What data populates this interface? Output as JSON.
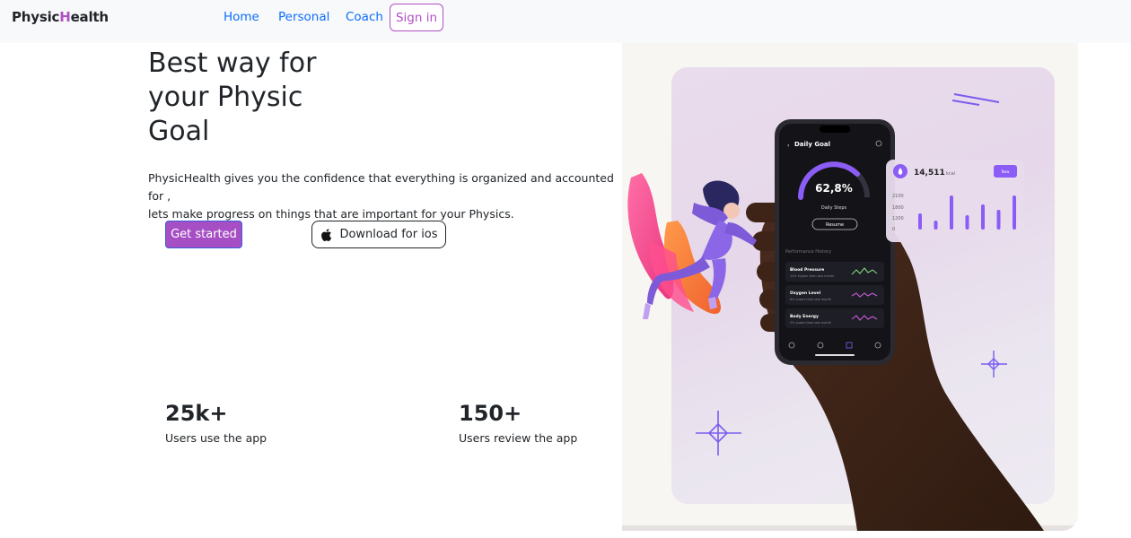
{
  "nav": {
    "brand_part1": "Physic",
    "brand_accent": "H",
    "brand_part2": "ealth",
    "links": [
      "Home",
      "Personal",
      "Coach"
    ],
    "signin": "Sign in"
  },
  "hero": {
    "title_line1": "Best way for",
    "title_line2": "your Physic",
    "title_line3": "Goal",
    "desc_line1": "PhysicHealth gives you the confidence that everything is organized and accounted for ,",
    "desc_line2": "lets make progress on things that are important for your Physics.",
    "btn_start": "Get started",
    "btn_ios": "Download for ios"
  },
  "stats": [
    {
      "value": "25k+",
      "label": "Users use the app"
    },
    {
      "value": "150+",
      "label": "Users review the app"
    }
  ],
  "phone": {
    "title": "Daily Goal",
    "percent": "62,8%",
    "subtitle": "Daily Steps",
    "resume": "Resume",
    "history_title": "Performance History",
    "rows": [
      {
        "name": "Blood Pressure",
        "note": "10% Higher than last month"
      },
      {
        "name": "Oxygen Level",
        "note": "8% Lower than last month"
      },
      {
        "name": "Body Energy",
        "note": "2% Lower than last month"
      }
    ]
  },
  "kcal_card": {
    "value": "14,511",
    "unit": "kcal",
    "button": "Now",
    "y_ticks": [
      "2100",
      "1800",
      "1200",
      "0"
    ],
    "bars": [
      0.45,
      0.25,
      0.95,
      0.4,
      0.7,
      0.55,
      0.95
    ]
  },
  "colors": {
    "accent": "#b14fc5",
    "link": "#0d6efd",
    "button": "#a64fc4"
  }
}
